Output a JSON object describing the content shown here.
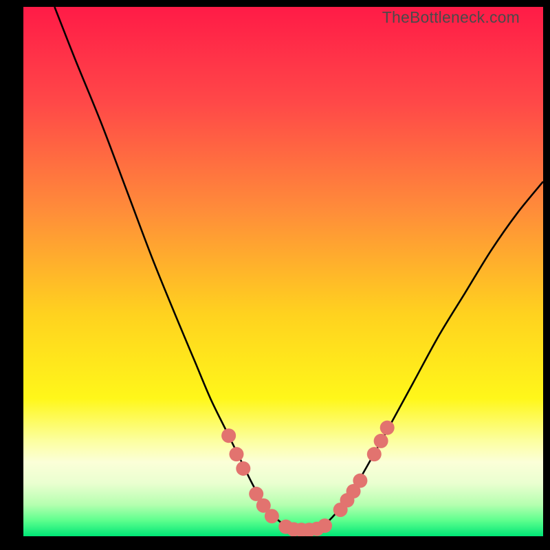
{
  "watermark": "TheBottleneck.com",
  "chart_data": {
    "type": "line",
    "title": "",
    "xlabel": "",
    "ylabel": "",
    "xlim": [
      0,
      100
    ],
    "ylim": [
      0,
      100
    ],
    "series": [
      {
        "name": "bottleneck-curve",
        "x": [
          6,
          10,
          15,
          20,
          25,
          30,
          33,
          36,
          39,
          42,
          44,
          46,
          48,
          50,
          52,
          54,
          56,
          58,
          60,
          63,
          66,
          70,
          75,
          80,
          85,
          90,
          95,
          100
        ],
        "y": [
          100,
          90,
          78,
          65,
          52,
          40,
          33,
          26,
          20,
          14,
          10,
          6.5,
          4,
          2.3,
          1.4,
          1.2,
          1.4,
          2.3,
          4.2,
          8,
          13,
          20,
          29,
          38,
          46,
          54,
          61,
          67
        ]
      }
    ],
    "markers": {
      "name": "highlighted-points",
      "color": "#e2736f",
      "points": [
        {
          "x": 39.5,
          "y": 19.0
        },
        {
          "x": 41.0,
          "y": 15.5
        },
        {
          "x": 42.3,
          "y": 12.8
        },
        {
          "x": 44.8,
          "y": 8.0
        },
        {
          "x": 46.2,
          "y": 5.8
        },
        {
          "x": 47.8,
          "y": 3.8
        },
        {
          "x": 50.5,
          "y": 1.8
        },
        {
          "x": 52.0,
          "y": 1.3
        },
        {
          "x": 53.5,
          "y": 1.2
        },
        {
          "x": 55.0,
          "y": 1.2
        },
        {
          "x": 56.5,
          "y": 1.4
        },
        {
          "x": 58.0,
          "y": 2.0
        },
        {
          "x": 61.0,
          "y": 5.0
        },
        {
          "x": 62.3,
          "y": 6.8
        },
        {
          "x": 63.5,
          "y": 8.5
        },
        {
          "x": 64.8,
          "y": 10.5
        },
        {
          "x": 67.5,
          "y": 15.5
        },
        {
          "x": 68.8,
          "y": 18.0
        },
        {
          "x": 70.0,
          "y": 20.5
        }
      ]
    },
    "gradient_stops": [
      {
        "pos": 0.0,
        "color": "#ff1b47"
      },
      {
        "pos": 0.18,
        "color": "#ff4848"
      },
      {
        "pos": 0.38,
        "color": "#ff8b3a"
      },
      {
        "pos": 0.58,
        "color": "#ffd21f"
      },
      {
        "pos": 0.74,
        "color": "#fff71a"
      },
      {
        "pos": 0.82,
        "color": "#fcffa0"
      },
      {
        "pos": 0.86,
        "color": "#fbffd8"
      },
      {
        "pos": 0.9,
        "color": "#eaffd0"
      },
      {
        "pos": 0.94,
        "color": "#b6ffb0"
      },
      {
        "pos": 0.97,
        "color": "#5eff8e"
      },
      {
        "pos": 1.0,
        "color": "#00e676"
      }
    ]
  }
}
